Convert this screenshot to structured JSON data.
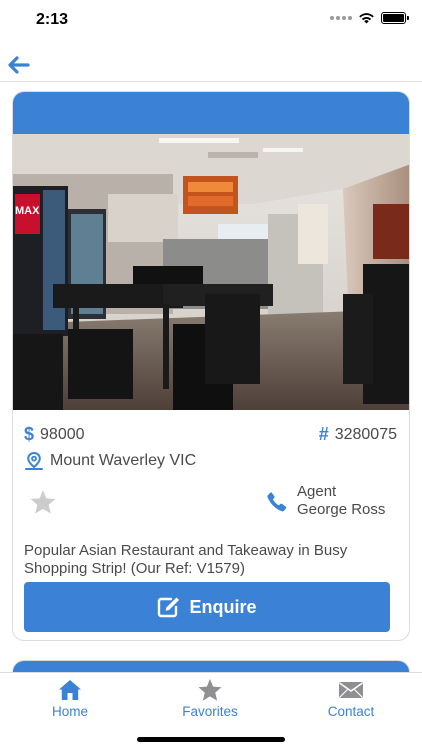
{
  "status_bar": {
    "time": "2:13"
  },
  "listing": {
    "price_symbol": "$",
    "price": "98000",
    "ref_symbol": "#",
    "ref_number": "3280075",
    "location": "Mount Waverley VIC",
    "agent_label": "Agent",
    "agent_name": "George Ross",
    "description": "Popular Asian Restaurant and Takeaway in Busy Shopping Strip! (Our Ref: V1579)",
    "enquire_label": "Enquire",
    "photo_sign_text": "MAX"
  },
  "tab_bar": {
    "tabs": [
      {
        "label": "Home",
        "icon": "home-icon"
      },
      {
        "label": "Favorites",
        "icon": "star-icon"
      },
      {
        "label": "Contact",
        "icon": "envelope-icon"
      }
    ]
  },
  "colors": {
    "accent": "#3b82d6",
    "text": "#4a4a4a",
    "inactive_star": "#cccccc",
    "tab_fav_icon": "#8e8e93"
  }
}
